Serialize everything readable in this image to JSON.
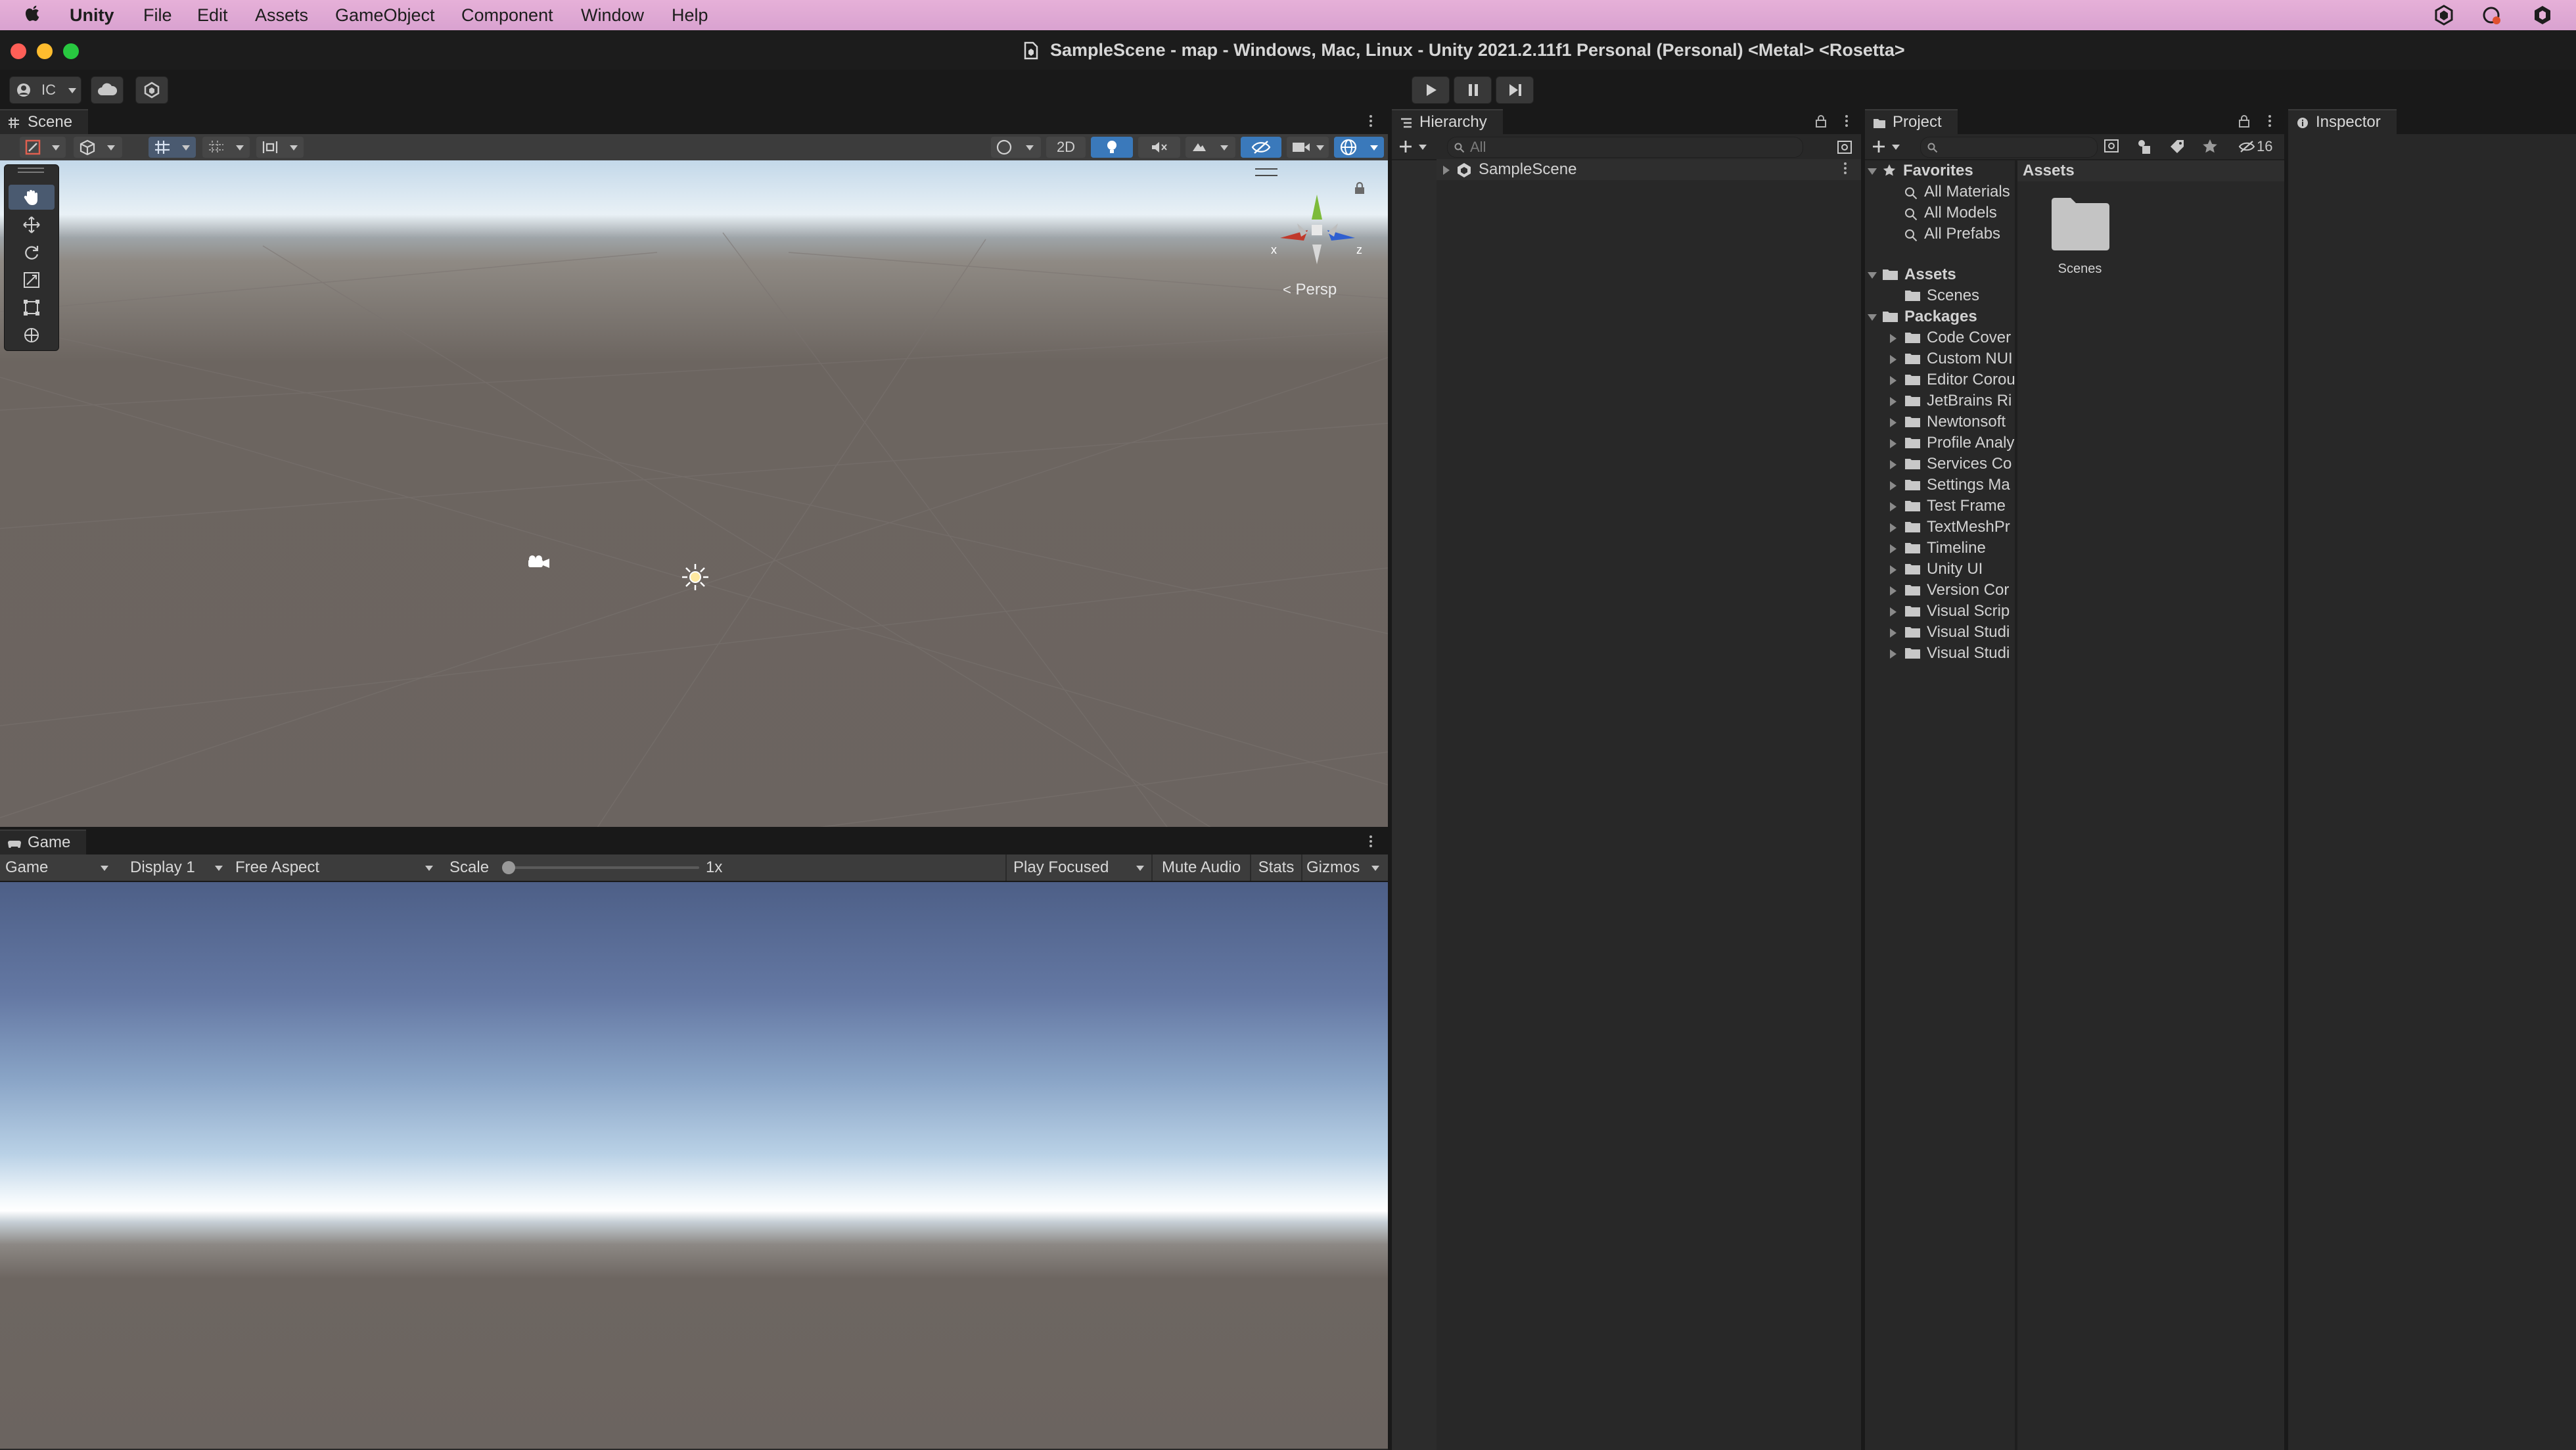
{
  "menubar": {
    "app": "Unity",
    "items": [
      "File",
      "Edit",
      "Assets",
      "GameObject",
      "Component",
      "Window",
      "Help"
    ]
  },
  "window": {
    "title": "SampleScene - map - Windows, Mac, Linux - Unity 2021.2.11f1 Personal (Personal) <Metal> <Rosetta>"
  },
  "toolbar": {
    "account_label": "IC",
    "play_icon": "play-icon",
    "pause_icon": "pause-icon",
    "step_icon": "step-icon"
  },
  "scene": {
    "tab": "Scene",
    "toggle_2d": "2D",
    "persp_label": "Persp",
    "axis_x": "x",
    "axis_z": "z"
  },
  "game": {
    "tab": "Game",
    "mode": "Game",
    "display": "Display 1",
    "aspect": "Free Aspect",
    "scale_label": "Scale",
    "scale_value": 0.0,
    "scale_text": "1x",
    "play_focused": "Play Focused",
    "mute_audio": "Mute Audio",
    "stats": "Stats",
    "gizmos": "Gizmos"
  },
  "hierarchy": {
    "tab": "Hierarchy",
    "search_placeholder": "All",
    "scene_item": "SampleScene"
  },
  "project": {
    "tab": "Project",
    "hidden_count": "16",
    "favorites_label": "Favorites",
    "favorites": [
      "All Materials",
      "All Models",
      "All Prefabs"
    ],
    "assets_label": "Assets",
    "assets_children": [
      "Scenes"
    ],
    "packages_label": "Packages",
    "packages": [
      "Code Cover",
      "Custom NUI",
      "Editor Corou",
      "JetBrains Ri",
      "Newtonsoft",
      "Profile Analy",
      "Services Co",
      "Settings Ma",
      "Test Frame",
      "TextMeshPr",
      "Timeline",
      "Unity UI",
      "Version Cor",
      "Visual Scrip",
      "Visual Studi",
      "Visual Studi"
    ],
    "grid_header": "Assets",
    "grid_items": [
      "Scenes"
    ]
  },
  "inspector": {
    "tab": "Inspector"
  },
  "colors": {
    "accent": "#3a79bb",
    "panel_bg": "#282828",
    "toolbar_bg": "#3c3c3c"
  }
}
